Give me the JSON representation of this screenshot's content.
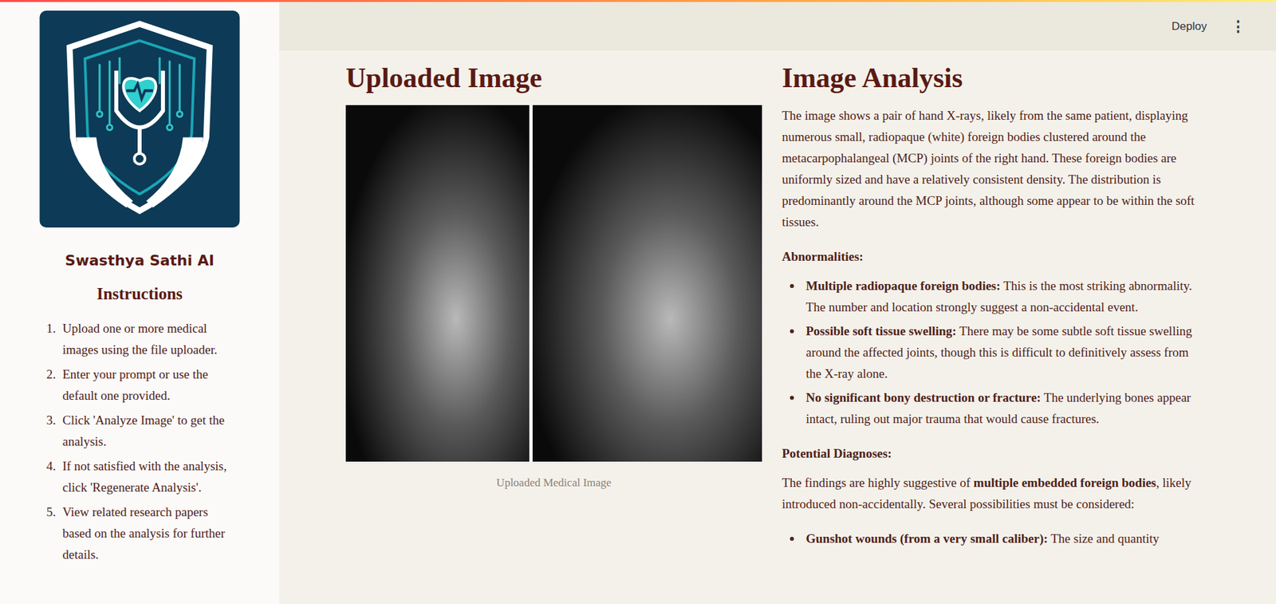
{
  "header": {
    "deploy": "Deploy",
    "menu": "⋮"
  },
  "sidebar": {
    "app_name": "Swasthya Sathi AI",
    "instructions_title": "Instructions",
    "instructions": [
      {
        "number": "1.",
        "text": "Upload one or more medical images using the file uploader."
      },
      {
        "number": "2.",
        "text": "Enter your prompt or use the default one provided."
      },
      {
        "number": "3.",
        "text": "Click 'Analyze Image' to get the analysis."
      },
      {
        "number": "4.",
        "text": "If not satisfied with the analysis, click 'Regenerate Analysis'."
      },
      {
        "number": "5.",
        "text": "View related research papers based on the analysis for further details."
      }
    ]
  },
  "image_panel": {
    "title": "Uploaded Image",
    "caption": "Uploaded Medical Image"
  },
  "analysis": {
    "title": "Image Analysis",
    "intro": "The image shows a pair of hand X-rays, likely from the same patient, displaying numerous small, radiopaque (white) foreign bodies clustered around the metacarpophalangeal (MCP) joints of the right hand. These foreign bodies are uniformly sized and have a relatively consistent density. The distribution is predominantly around the MCP joints, although some appear to be within the soft tissues.",
    "abnormalities_heading": "Abnormalities:",
    "abnormalities": [
      {
        "label": "Multiple radiopaque foreign bodies:",
        "text": "This is the most striking abnormality. The number and location strongly suggest a non-accidental event."
      },
      {
        "label": "Possible soft tissue swelling:",
        "text": "There may be some subtle soft tissue swelling around the affected joints, though this is difficult to definitively assess from the X-ray alone."
      },
      {
        "label": "No significant bony destruction or fracture:",
        "text": "The underlying bones appear intact, ruling out major trauma that would cause fractures."
      }
    ],
    "diagnoses_heading": "Potential Diagnoses:",
    "diagnoses_intro": [
      {
        "text": "The findings are highly suggestive of ",
        "bold": false
      },
      {
        "text": "multiple embedded foreign bodies",
        "bold": true
      },
      {
        "text": ", likely introduced non-accidentally. Several possibilities must be considered:",
        "bold": false
      }
    ],
    "diagnoses": [
      {
        "label": "Gunshot wounds (from a very small caliber):",
        "text": "The size and quantity"
      }
    ]
  }
}
